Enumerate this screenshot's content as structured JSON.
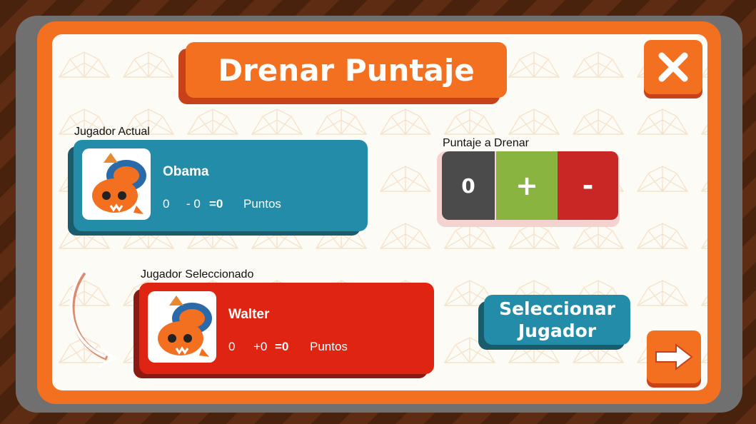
{
  "header": {
    "title": "Drenar Puntaje"
  },
  "current_player": {
    "section_label": "Jugador Actual",
    "name": "Obama",
    "score": "0",
    "delta": "- 0",
    "total": "=0",
    "points_label": "Puntos"
  },
  "selected_player": {
    "section_label": "Jugador Seleccionado",
    "name": "Walter",
    "score": "0",
    "delta": "+0",
    "total": "=0",
    "points_label": "Puntos"
  },
  "drain": {
    "label": "Puntaje a Drenar",
    "value": "0",
    "plus_label": "+",
    "minus_label": "-"
  },
  "select_button": {
    "line1": "Seleccionar",
    "line2": "Jugador"
  },
  "icons": {
    "close": "close-icon",
    "next": "arrow-right-icon",
    "avatar": "crab-creature-avatar",
    "curve": "curved-arrow-icon"
  },
  "colors": {
    "orange": "#f37021",
    "blue": "#238ca8",
    "red": "#e02412",
    "green": "#8ab440",
    "dark_red": "#c92626",
    "gray": "#4b4b4b"
  }
}
